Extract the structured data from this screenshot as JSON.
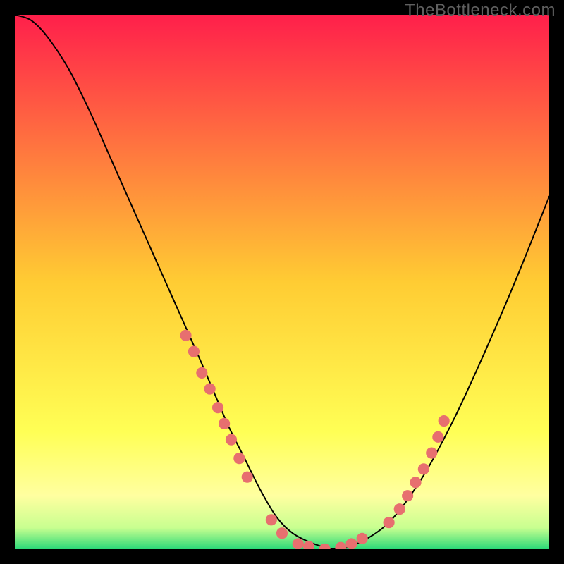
{
  "watermark": "TheBottleneck.com",
  "colors": {
    "page_bg": "#000000",
    "gradient_stops": [
      {
        "offset": "0%",
        "color": "#ff1f4b"
      },
      {
        "offset": "50%",
        "color": "#ffcc33"
      },
      {
        "offset": "78%",
        "color": "#ffff55"
      },
      {
        "offset": "90%",
        "color": "#ffffa0"
      },
      {
        "offset": "96%",
        "color": "#c8ff90"
      },
      {
        "offset": "100%",
        "color": "#2bd978"
      }
    ],
    "curve_stroke": "#000000",
    "marker_fill": "#e76f6f",
    "marker_stroke": "#e76f6f"
  },
  "chart_data": {
    "type": "line",
    "title": "",
    "xlabel": "",
    "ylabel": "",
    "xlim": [
      0,
      100
    ],
    "ylim": [
      0,
      100
    ],
    "grid": false,
    "legend": false,
    "series": [
      {
        "name": "bottleneck-curve",
        "x": [
          0,
          3,
          6,
          10,
          14,
          18,
          22,
          26,
          30,
          34,
          37,
          40,
          43,
          46,
          49,
          52,
          56,
          60,
          64,
          70,
          76,
          82,
          88,
          94,
          100
        ],
        "y": [
          100,
          99,
          96,
          90,
          82,
          73,
          64,
          55,
          46,
          37,
          30,
          23,
          17,
          11,
          6,
          3,
          1,
          0,
          1,
          5,
          13,
          24,
          37,
          51,
          66
        ]
      }
    ],
    "markers": {
      "name": "gpu-sample-points",
      "radius_percent": 1.0,
      "points": [
        {
          "x": 32,
          "y": 40
        },
        {
          "x": 33.5,
          "y": 37
        },
        {
          "x": 35,
          "y": 33
        },
        {
          "x": 36.5,
          "y": 30
        },
        {
          "x": 38,
          "y": 26.5
        },
        {
          "x": 39.2,
          "y": 23.5
        },
        {
          "x": 40.5,
          "y": 20.5
        },
        {
          "x": 42,
          "y": 17
        },
        {
          "x": 43.5,
          "y": 13.5
        },
        {
          "x": 48,
          "y": 5.5
        },
        {
          "x": 50,
          "y": 3
        },
        {
          "x": 53,
          "y": 1
        },
        {
          "x": 55,
          "y": 0.5
        },
        {
          "x": 58,
          "y": 0
        },
        {
          "x": 61,
          "y": 0.3
        },
        {
          "x": 63,
          "y": 1
        },
        {
          "x": 65,
          "y": 2
        },
        {
          "x": 70,
          "y": 5
        },
        {
          "x": 72,
          "y": 7.5
        },
        {
          "x": 73.5,
          "y": 10
        },
        {
          "x": 75,
          "y": 12.5
        },
        {
          "x": 76.5,
          "y": 15
        },
        {
          "x": 78,
          "y": 18
        },
        {
          "x": 79.2,
          "y": 21
        },
        {
          "x": 80.3,
          "y": 24
        }
      ]
    }
  }
}
